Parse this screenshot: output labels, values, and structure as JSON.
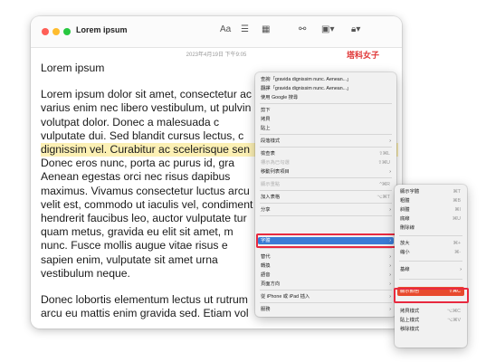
{
  "window": {
    "title": "Lorem ipsum",
    "date": "2023年4月19日 下午9:05",
    "toolbar_icons": [
      "font-icon",
      "checklist-icon",
      "table-icon",
      "share-icon",
      "media-icon",
      "lock-icon"
    ],
    "toolbar_font_label": "Aa"
  },
  "watermark": {
    "text": "塔科女子"
  },
  "document": {
    "heading": "Lorem ipsum",
    "lines": [
      "Lorem ipsum dolor sit amet, consectetur ac",
      "varius enim nec libero vestibulum, ut pulvin",
      "volutpat dolor. Donec a malesuada c",
      "vulputate dui. Sed blandit cursus lectus, c",
      "dignissim vel. Curabitur ac scelerisque sen",
      "Donec eros nunc, porta ac purus id, gra",
      "Aenean egestas orci nec risus dapibus",
      "maximus. Vivamus consectetur luctus arcu",
      "velit est, commodo ut iaculis vel, condiment",
      "hendrerit faucibus leo, auctor vulputate tur",
      "quam metus, gravida eu elit sit amet, m",
      "nunc. Fusce mollis augue vitae risus e",
      "sapien enim, vulputate sit amet urna",
      "vestibulum neque."
    ],
    "para2": [
      "Donec lobortis elementum lectus ut rutrum",
      "arcu eu mattis enim gravida sed. Etiam vol"
    ]
  },
  "context_menu": {
    "lookup": "查詢「gravida dignissim nunc. Aenean...」",
    "translate": "翻譯「gravida dignissim nunc. Aenean...」",
    "google": "使用 Google 搜尋",
    "cut": "剪下",
    "copy": "拷貝",
    "paste": "貼上",
    "paragraph_style": "段落樣式",
    "check_box": "檢查表",
    "check_box_sc": "⇧⌘L",
    "mark_checked": "標示為已勾選",
    "mark_checked_sc": "⇧⌘U",
    "move_list": "移動列表項目",
    "show_highlights": "顯示重點",
    "show_highlights_sc": "^⌘R",
    "add_table": "加入表格",
    "add_table_sc": "⌥⌘T",
    "share": "分享",
    "font": "字體",
    "substitutions": "替代",
    "transformations": "轉換",
    "speech": "語音",
    "page_direction": "頁面方向",
    "import_iphone": "從 iPhone 或 iPad 插入",
    "services": "服務"
  },
  "font_menu": {
    "show_fonts": "顯示字體",
    "show_fonts_sc": "⌘T",
    "bold": "粗體",
    "bold_sc": "⌘B",
    "italic": "斜體",
    "italic_sc": "⌘I",
    "underline": "底線",
    "underline_sc": "⌘U",
    "strikethrough": "刪除線",
    "bigger": "放大",
    "bigger_sc": "⌘+",
    "smaller": "縮小",
    "smaller_sc": "⌘-",
    "baseline": "基線",
    "show_colors": "顯示顏色",
    "show_colors_sc": "⇧⌘C",
    "copy_style": "拷貝樣式",
    "copy_style_sc": "⌥⌘C",
    "paste_style": "貼上樣式",
    "paste_style_sc": "⌥⌘V",
    "remove_style": "移除樣式"
  },
  "colors": {
    "highlight": "#e8293f",
    "selection": "#3a7bd5"
  }
}
